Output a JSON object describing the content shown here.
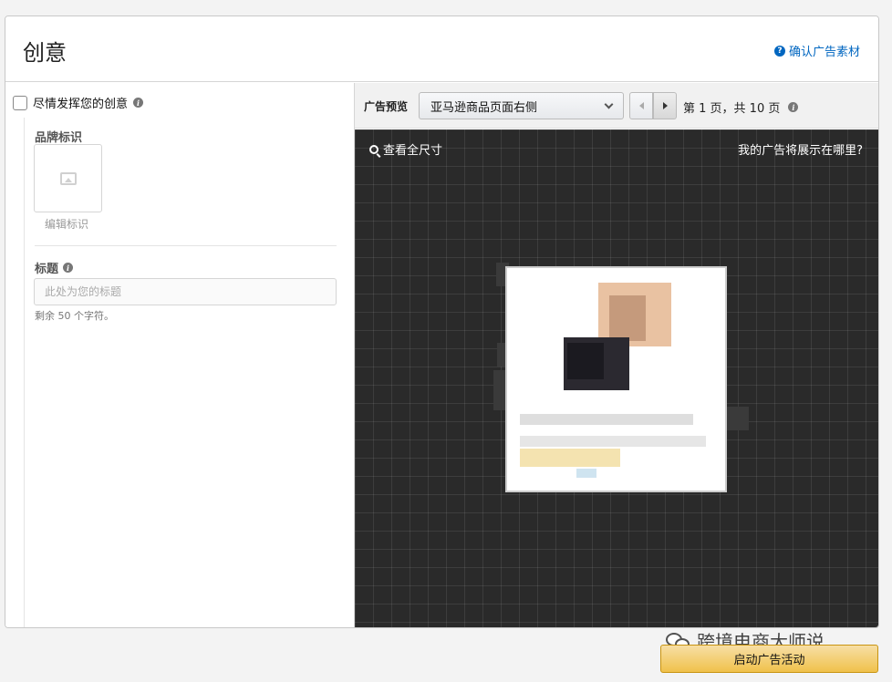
{
  "header": {
    "title": "创意",
    "confirm_link": "确认广告素材",
    "help_icon": "question-circle-icon"
  },
  "left_panel": {
    "checkbox_label": "尽情发挥您的创意",
    "brand_logo_label": "品牌标识",
    "edit_logo": "编辑标识",
    "headline_label": "标题",
    "headline_placeholder": "此处为您的标题",
    "chars_remaining": "剩余 50 个字符。",
    "info_icon": "info-circle-icon"
  },
  "preview": {
    "label": "广告预览",
    "placement_selected": "亚马逊商品页面右侧",
    "page_info": "第 1 页，共 10 页",
    "view_full_size": "查看全尺寸",
    "where_shown": "我的广告将展示在哪里?"
  },
  "footer": {
    "launch_button": "启动广告活动",
    "watermark": "跨境电商大师说"
  },
  "colors": {
    "link": "#0066c0",
    "canvas_bg": "#2a2a2a",
    "launch_button": "#f0c14b"
  }
}
